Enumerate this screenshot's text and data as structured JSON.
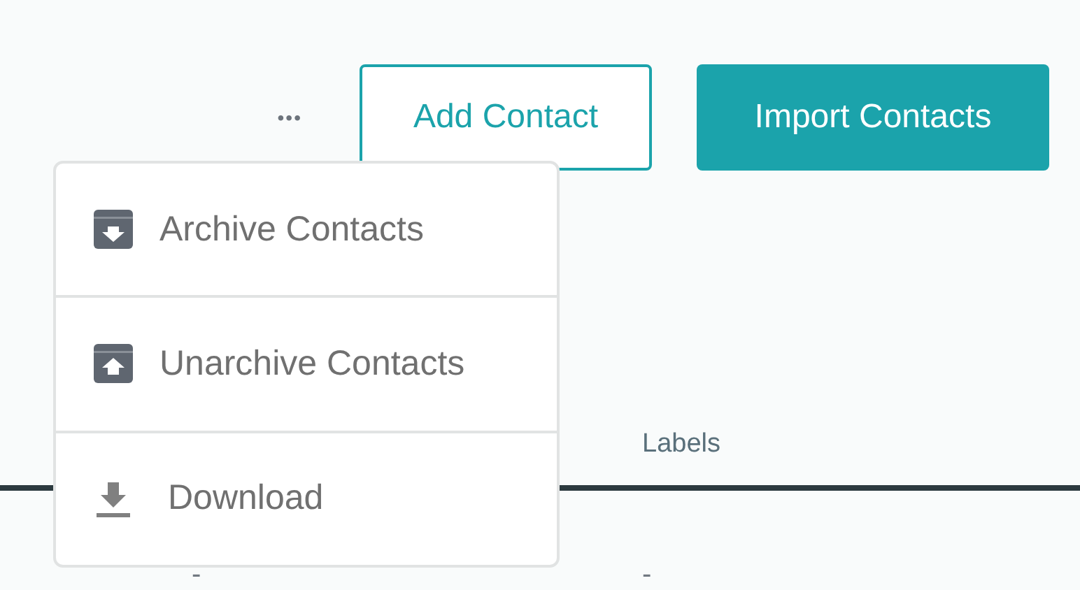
{
  "toolbar": {
    "more_label": "•••",
    "buttons": [
      {
        "label": "Add Contact",
        "kind": "outline"
      },
      {
        "label": "Import Contacts",
        "kind": "filled"
      }
    ]
  },
  "menu": {
    "items": [
      {
        "label": "Archive Contacts",
        "kind": "archive"
      },
      {
        "label": "Unarchive Contacts",
        "kind": "unarchive"
      },
      {
        "label": "Download",
        "kind": "download"
      }
    ]
  },
  "table": {
    "columns": [
      null,
      {
        "label": "Labels"
      }
    ],
    "rows": [
      {
        "cells": [
          "-",
          "-"
        ]
      }
    ]
  }
}
